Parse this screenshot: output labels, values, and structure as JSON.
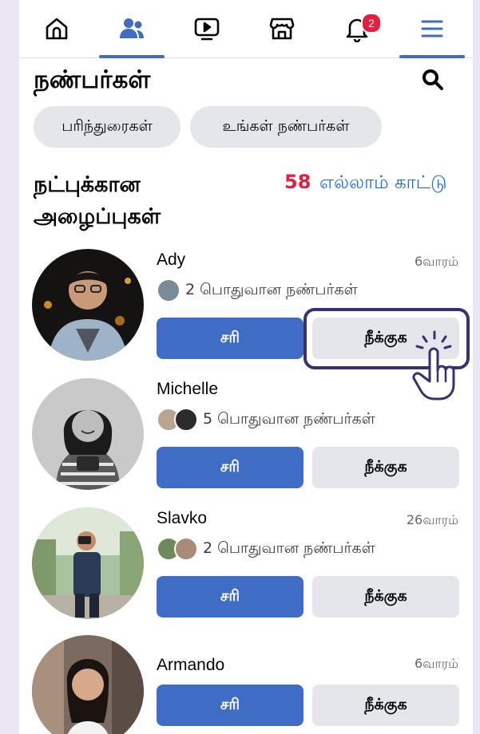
{
  "nav": {
    "items": [
      {
        "name": "home",
        "icon": "home-icon",
        "active": false
      },
      {
        "name": "friends",
        "icon": "friends-icon",
        "active": true
      },
      {
        "name": "video",
        "icon": "video-icon",
        "active": false
      },
      {
        "name": "marketplace",
        "icon": "marketplace-icon",
        "active": false
      },
      {
        "name": "notifications",
        "icon": "bell-icon",
        "active": false,
        "badge": "2"
      },
      {
        "name": "menu",
        "icon": "menu-icon",
        "active": false
      }
    ],
    "accent": "#3f6cc4"
  },
  "page": {
    "title": "நண்பர்கள்",
    "chips": [
      "பரிந்துரைகள்",
      "உங்கள் நண்பர்கள்"
    ],
    "section_title": "நட்புக்கான அழைப்புகள்",
    "request_count": "58",
    "see_all": "எல்லாம் காட்டு"
  },
  "requests": [
    {
      "name": "Ady",
      "time": "6வாரம்",
      "mutual": "2 பொதுவான நண்பர்கள்",
      "confirm": "சரி",
      "remove": "நீக்குக"
    },
    {
      "name": "Michelle",
      "time": "",
      "mutual": "5 பொதுவான நண்பர்கள்",
      "confirm": "சரி",
      "remove": "நீக்குக"
    },
    {
      "name": "Slavko",
      "time": "26வாரம்",
      "mutual": "2 பொதுவான நண்பர்கள்",
      "confirm": "சரி",
      "remove": "நீக்குக"
    },
    {
      "name": "Armando",
      "time": "6வாரம்",
      "mutual": "",
      "confirm": "சரி",
      "remove": "நீக்குக"
    }
  ],
  "colors": {
    "confirm_button": "#3f6cc4",
    "remove_button": "#e4e6eb",
    "count": "#e41e3f",
    "link": "#216fdb",
    "highlight": "#3b2f6d"
  }
}
